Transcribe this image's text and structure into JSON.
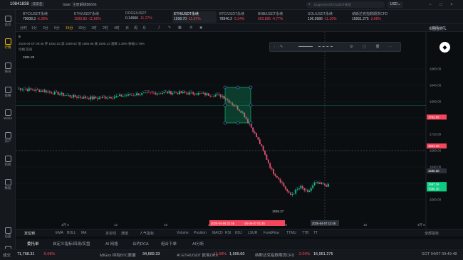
{
  "app": {
    "account": "10841838",
    "account_badge": "未实名",
    "notice": "Gate: 注册解锁$6666"
  },
  "sidebar": {
    "items": [
      {
        "label": "首页"
      },
      {
        "label": "行情"
      },
      {
        "label": "快讯"
      },
      {
        "label": "策略"
      },
      {
        "label": "Web3"
      },
      {
        "label": "资产"
      },
      {
        "label": "新闻"
      },
      {
        "label": "数据"
      },
      {
        "label": "设置"
      },
      {
        "label": "客服"
      }
    ]
  },
  "tickers": [
    {
      "name": "BTC/USDT永续",
      "price": "79008.3",
      "change": "-5.28%"
    },
    {
      "name": "ETH/USDT永续",
      "price": "1599.83",
      "change": "-11.66%"
    },
    {
      "name": "DOGE/USDT",
      "price": "0.14966",
      "change": "-11.27%"
    },
    {
      "name": "ETH/USDT永续",
      "price": "1598.70",
      "change": "-11.67%"
    },
    {
      "name": "BTC/USDT永续",
      "price": "78946.2",
      "change": "-5.34%"
    },
    {
      "name": "BNB/USDT永续",
      "price": "563.895",
      "change": "-4.77%"
    },
    {
      "name": "SOL/USDT永续",
      "price": "106.9986",
      "change": "-11.10%"
    },
    {
      "name": "纳斯达克指数期货CFD",
      "price": "16951.275",
      "change": "-3.06%"
    }
  ],
  "search": {
    "placeholder": "Dogecoin BTC/USDT永续"
  },
  "currency": "USD",
  "toolbar": {
    "timeframes": [
      "分时",
      "1分",
      "3分",
      "5分",
      "15分",
      "30分",
      "1时",
      "2时",
      "4时",
      "日",
      "周",
      "月"
    ],
    "active": "15分",
    "layout": "布局分享"
  },
  "chart_info": {
    "ohlc": "2025-04-07 09:45 开 1592.03 高 1599.62 低 1586.96 收 1595.13 涨跌 1.38% 振幅 0.78%",
    "overlay": "均线 区间"
  },
  "price_axis": {
    "labels": [
      "1880.00",
      "1840.00",
      "1800.00",
      "1760.00",
      "1720.00",
      "1680.00",
      "1640.00",
      "1600.00",
      "1560.00"
    ],
    "tags": [
      {
        "text": "1762.06",
        "color": "#f6465d"
      },
      {
        "text": "1691.40",
        "color": "#f6465d"
      },
      {
        "text": "1630.30",
        "color": "#2b3139"
      },
      {
        "text": "1597.16",
        "color": "#0ecb81"
      },
      {
        "text": "1586.20",
        "color": "#0ecb81"
      }
    ]
  },
  "time_axis": {
    "labels": [
      "4月 6",
      "12",
      "18",
      "4月 7",
      "06",
      "12",
      "18",
      "4月 8"
    ],
    "markers": [
      "2025-04-06 21:45",
      "-25-04-07 01:45",
      "2025-04-07 12:45"
    ]
  },
  "chart_labels": {
    "high": "1821.26",
    "low": "1535.27"
  },
  "indicators": {
    "left": "定位到",
    "items": [
      "EMA",
      "BOLL",
      "MA",
      "多空线",
      "通道",
      "人气指标",
      "Volume",
      "Position",
      "MACD",
      "RSI",
      "KDJ",
      "LSUR",
      "FundFlow",
      "TTMU",
      "TTB",
      "TT"
    ],
    "right": "全部指标"
  },
  "bottom_tabs": [
    "委托单",
    "自定义指标/回测/实盘",
    "AI 网格",
    "合约DCA",
    "组合下单",
    "AI分析"
  ],
  "status": {
    "market": "成交",
    "price": "71,768.31",
    "price_change": "-5.08%",
    "item1": "MtGox 持有BTC数量",
    "item1_val": "34,689.33",
    "item2": "AI ETH/USDT 欧易OKX",
    "item2_change": "-11.68%",
    "item2_price": "1,599.60",
    "item3": "纳斯达克指数期货CFD",
    "item3_change": "-3.06%",
    "item3_price": "16,951.275",
    "time": "SGT 04/07 09:49:48",
    "theme": "暗"
  },
  "colors": {
    "up": "#0ecb81",
    "down": "#f6465d",
    "accent": "#f0b90b",
    "bg": "#0b0e11"
  }
}
